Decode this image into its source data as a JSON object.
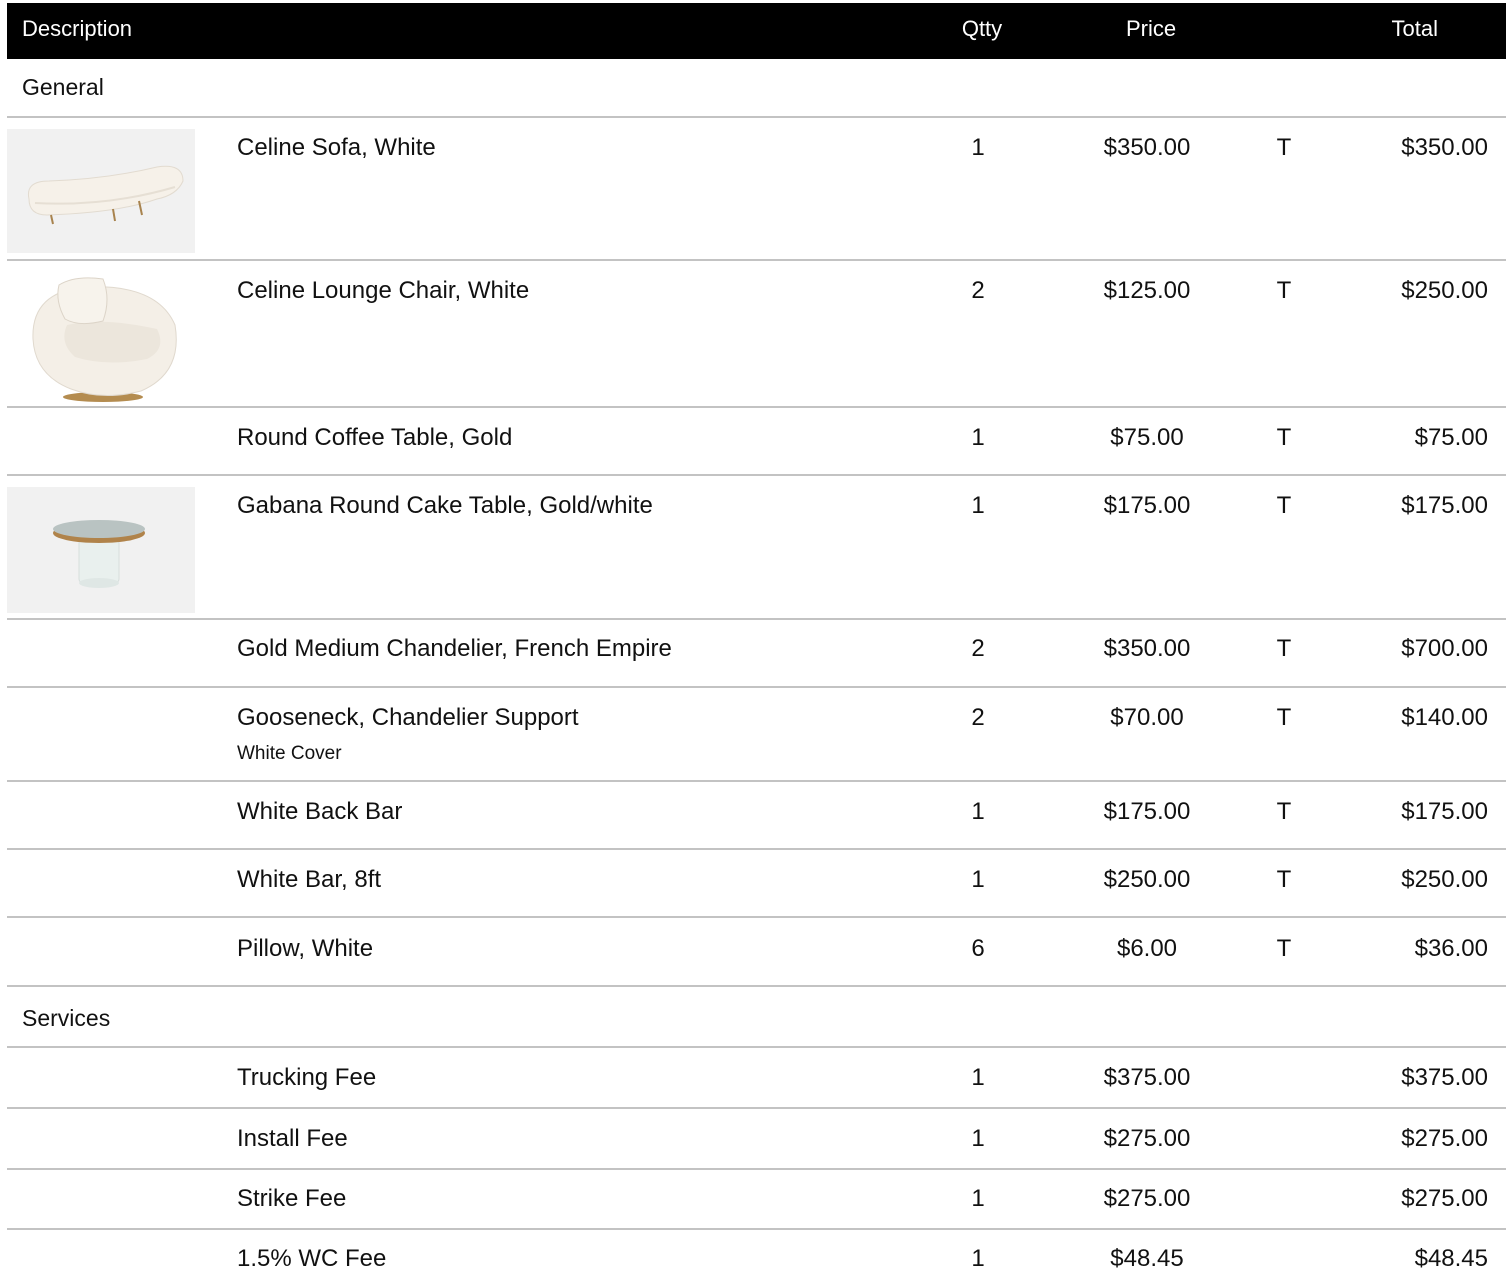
{
  "header": {
    "description": "Description",
    "qty": "Qtty",
    "price": "Price",
    "total": "Total"
  },
  "sections": {
    "general": "General",
    "services": "Services"
  },
  "general_items": [
    {
      "description": "Celine Sofa, White",
      "qty": "1",
      "price": "$350.00",
      "tax": "T",
      "total": "$350.00",
      "image": "white-curved-sofa"
    },
    {
      "description": "Celine Lounge Chair, White",
      "qty": "2",
      "price": "$125.00",
      "tax": "T",
      "total": "$250.00",
      "image": "white-lounge-chair"
    },
    {
      "description": "Round Coffee Table, Gold",
      "qty": "1",
      "price": "$75.00",
      "tax": "T",
      "total": "$75.00"
    },
    {
      "description": "Gabana Round Cake Table, Gold/white",
      "qty": "1",
      "price": "$175.00",
      "tax": "T",
      "total": "$175.00",
      "image": "round-cake-table"
    },
    {
      "description": "Gold Medium Chandelier, French Empire",
      "qty": "2",
      "price": "$350.00",
      "tax": "T",
      "total": "$700.00"
    },
    {
      "description": "Gooseneck, Chandelier Support",
      "note": "White Cover",
      "qty": "2",
      "price": "$70.00",
      "tax": "T",
      "total": "$140.00"
    },
    {
      "description": "White Back Bar",
      "qty": "1",
      "price": "$175.00",
      "tax": "T",
      "total": "$175.00"
    },
    {
      "description": "White Bar, 8ft",
      "qty": "1",
      "price": "$250.00",
      "tax": "T",
      "total": "$250.00"
    },
    {
      "description": "Pillow, White",
      "qty": "6",
      "price": "$6.00",
      "tax": "T",
      "total": "$36.00"
    }
  ],
  "service_items": [
    {
      "description": "Trucking Fee",
      "qty": "1",
      "price": "$375.00",
      "total": "$375.00"
    },
    {
      "description": "Install Fee",
      "qty": "1",
      "price": "$275.00",
      "total": "$275.00"
    },
    {
      "description": "Strike Fee",
      "qty": "1",
      "price": "$275.00",
      "total": "$275.00"
    },
    {
      "description": "1.5% WC Fee",
      "qty": "1",
      "price": "$48.45",
      "total": "$48.45"
    }
  ]
}
